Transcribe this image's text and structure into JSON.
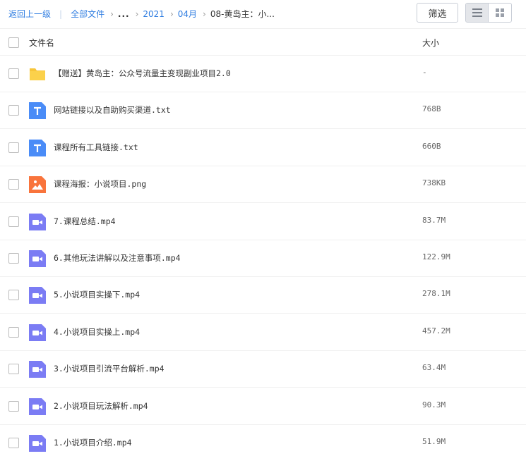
{
  "breadcrumb": {
    "back": "返回上一级",
    "root": "全部文件",
    "ellipsis": "...",
    "year": "2021",
    "month": "04月",
    "current": "08-黄岛主：小..."
  },
  "toolbar": {
    "filter_label": "筛选",
    "view_mode": "list"
  },
  "table": {
    "col_name": "文件名",
    "col_size": "大小"
  },
  "files": [
    {
      "name": "【赠送】黄岛主：公众号流量主变现副业项目2.0",
      "size": "-",
      "icon": "folder-icon"
    },
    {
      "name": "网站链接以及自助购买渠道.txt",
      "size": "768B",
      "icon": "text-file-icon"
    },
    {
      "name": "课程所有工具链接.txt",
      "size": "660B",
      "icon": "text-file-icon"
    },
    {
      "name": "课程海报：小说项目.png",
      "size": "738KB",
      "icon": "image-file-icon"
    },
    {
      "name": "7.课程总结.mp4",
      "size": "83.7M",
      "icon": "video-file-icon"
    },
    {
      "name": "6.其他玩法讲解以及注意事项.mp4",
      "size": "122.9M",
      "icon": "video-file-icon"
    },
    {
      "name": "5.小说项目实操下.mp4",
      "size": "278.1M",
      "icon": "video-file-icon"
    },
    {
      "name": "4.小说项目实操上.mp4",
      "size": "457.2M",
      "icon": "video-file-icon"
    },
    {
      "name": "3.小说项目引流平台解析.mp4",
      "size": "63.4M",
      "icon": "video-file-icon"
    },
    {
      "name": "2.小说项目玩法解析.mp4",
      "size": "90.3M",
      "icon": "video-file-icon"
    },
    {
      "name": "1.小说项目介绍.mp4",
      "size": "51.9M",
      "icon": "video-file-icon"
    }
  ],
  "colors": {
    "link": "#2f7de1",
    "folder": "#fbd14b",
    "text_file": "#4a8cf7",
    "image_file": "#f9743c",
    "video_file": "#7b7cf4"
  }
}
